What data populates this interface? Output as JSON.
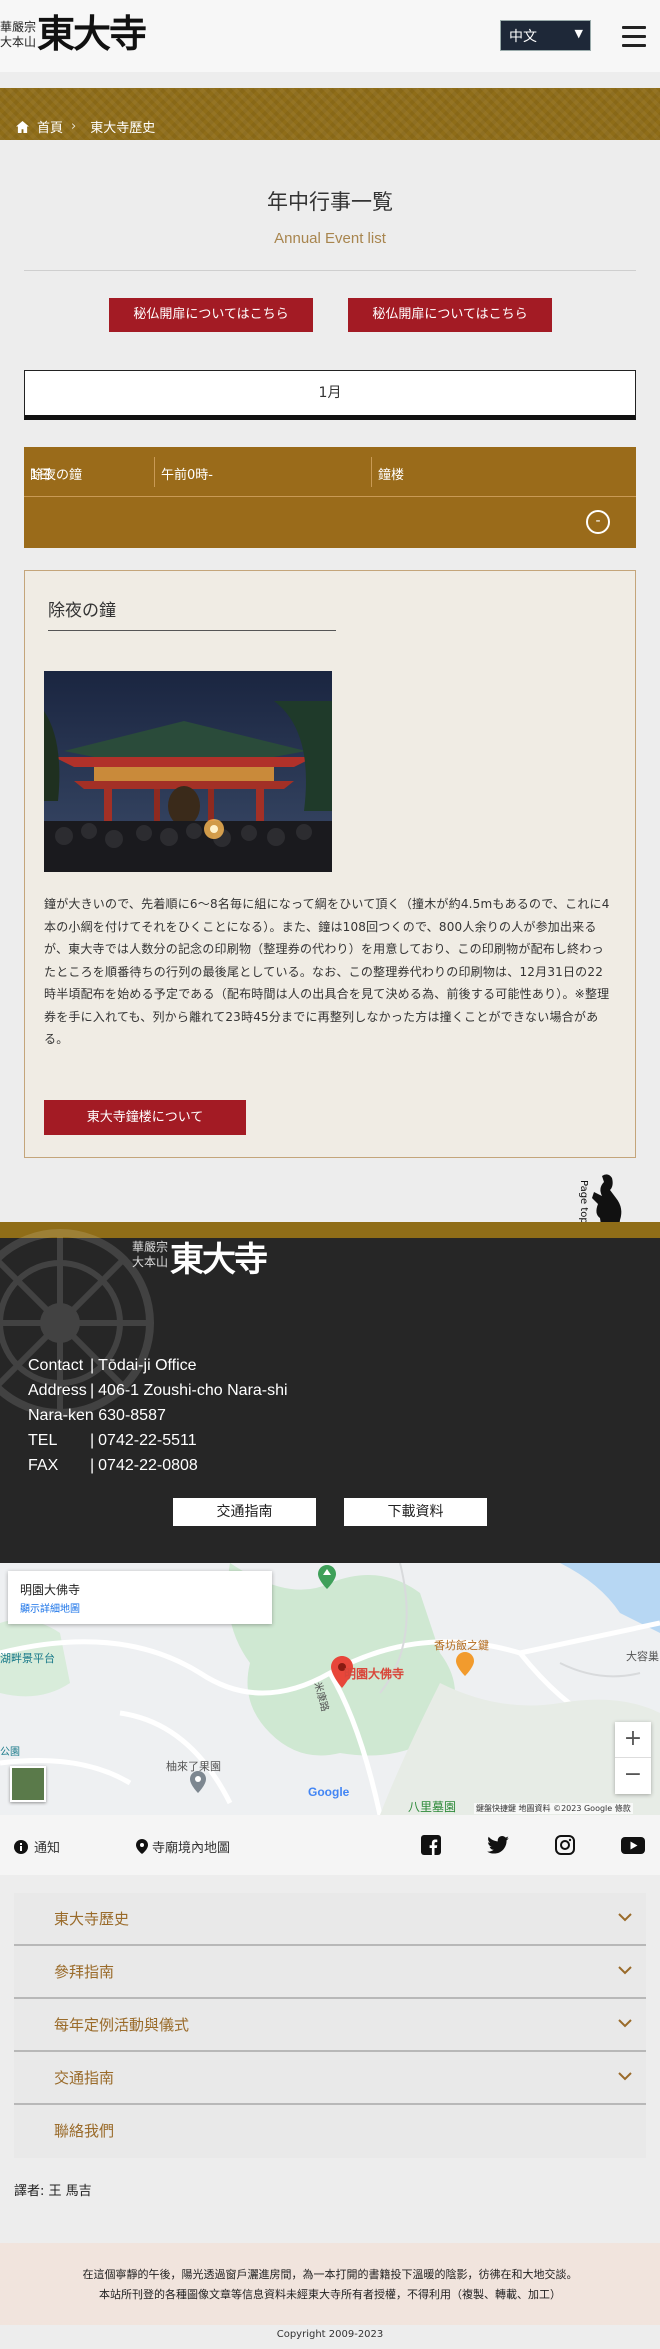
{
  "header": {
    "logo_small": "華嚴宗大本山",
    "logo_main": "東大寺",
    "language": "中文"
  },
  "breadcrumb": {
    "home": "首頁",
    "current": "東大寺歷史"
  },
  "page": {
    "title": "年中行事一覧",
    "subtitle": "Annual Event list",
    "btn_left": "秘仏開扉についてはこちら",
    "btn_right": "秘仏開扉についてはこちら",
    "month": "1月"
  },
  "event": {
    "day": "1日",
    "time": "午前0時-",
    "place": "鐘楼",
    "name": "除夜の鐘",
    "toggle": "-"
  },
  "detail": {
    "title": "除夜の鐘",
    "paragraph": "鐘が大きいので、先着順に6～8名毎に組になって綱をひいて頂く（撞木が約4.5mもあるので、これに4本の小綱を付けてそれをひくことになる）。また、鐘は108回つくので、800人余りの人が参加出来るが、東大寺では人数分の記念の印刷物（整理券の代わり）を用意しており、この印刷物が配布し終わったところを順番待ちの行列の最後尾としている。なお、この整理券代わりの印刷物は、12月31日の22時半頃配布を始める予定である（配布時間は人の出具合を見て決める為、前後する可能性あり）。※整理券を手に入れても、列から離れて23時45分までに再整列しなかった方は撞くことができない場合がある。",
    "button": "東大寺鐘楼について"
  },
  "page_top": "Page top",
  "footer": {
    "logo_small": "華嚴宗大本山",
    "logo_main": "東大寺",
    "contact_label": "Contact",
    "contact_value": "Tōdai-ji Office",
    "address_label": "Address",
    "address_line1": "406-1 Zoushi-cho Nara-shi",
    "address_line2": "Nara-ken 630-8587",
    "tel_label": "TEL",
    "tel_value": "0742-22-5511",
    "fax_label": "FAX",
    "fax_value": "0742-22-0808",
    "btn_access": "交通指南",
    "btn_download": "下載資料"
  },
  "map": {
    "place_name": "明園大佛寺",
    "view_larger": "顯示詳細地圖",
    "pin_label": "明園大佛寺",
    "labels": [
      "香坊飯之鍵",
      "湖畔景平台",
      "柚來了果園",
      "八里墓園",
      "大容巢",
      "公園",
      "米康路"
    ],
    "google": "Google",
    "attribution": "鍵盤快捷鍵  地圖資料 ©2023 Google  條款",
    "zoom_in": "+",
    "zoom_out": "−"
  },
  "bottom_nav": {
    "notice": "通知",
    "temple_map": "寺廟境內地圖"
  },
  "accordion": [
    "東大寺歷史",
    "參拜指南",
    "每年定例活動與儀式",
    "交通指南",
    "聯絡我們"
  ],
  "translator": "譯者: 王 馬吉",
  "notice_lines": [
    "在這個寧靜的午後，陽光透過窗戶灑進房間，為一本打開的書籍投下溫暖的陰影，彷彿在和大地交談。",
    "本站所刊登的各種圖像文章等信息資料未經東大寺所有者授權，不得利用（複製、轉載、加工）"
  ],
  "copyright": "Copyright 2009-2023",
  "colors": {
    "gold": "#8f6d18",
    "red": "#a31b24",
    "dark": "#262626"
  }
}
